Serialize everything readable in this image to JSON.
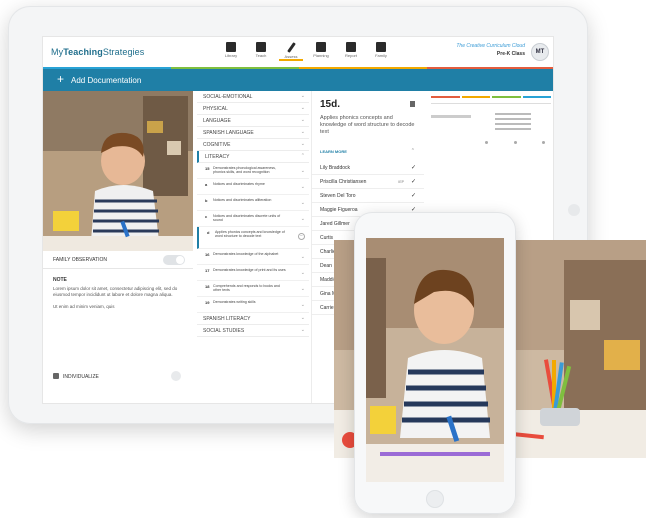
{
  "app": {
    "logo_prefix": "My",
    "logo_bold": "Teaching",
    "logo_suffix": "Strategies",
    "curriculum": "The Creative Curriculum Cloud",
    "class_name": "Pre-K Class",
    "avatar_initials": "MT"
  },
  "nav": [
    {
      "label": "Library",
      "icon": "library-icon"
    },
    {
      "label": "Teach",
      "icon": "teach-icon"
    },
    {
      "label": "Assess",
      "icon": "assess-pen-icon"
    },
    {
      "label": "Planning",
      "icon": "planning-icon"
    },
    {
      "label": "Report",
      "icon": "report-icon"
    },
    {
      "label": "Family",
      "icon": "family-icon"
    }
  ],
  "colors": {
    "brand": "#1f7fa6",
    "accent": "#f2a900"
  },
  "docbar": {
    "label": "Add Documentation"
  },
  "left": {
    "family_label": "FAMILY OBSERVATION",
    "note_heading": "NOTE",
    "note_body_1": "Lorem ipsum dolor sit amet, consectetur adipiscing elit, sed do eiusmod tempor incididunt ut labore et dolore magna aliqua.",
    "note_body_2": "Ut enim ad minim veniam, quis",
    "individualize": "INDIVIDUALIZE"
  },
  "domains_top": [
    "SOCIAL-EMOTIONAL",
    "PHYSICAL",
    "LANGUAGE",
    "SPANISH LANGUAGE",
    "COGNITIVE",
    "LITERACY"
  ],
  "objectives": [
    {
      "num": "15",
      "text": "Demonstrates phonological awareness, phonics skills, and word recognition"
    },
    {
      "num": "a",
      "text": "Notices and discriminates rhyme"
    },
    {
      "num": "b",
      "text": "Notices and discriminates alliteration"
    },
    {
      "num": "c",
      "text": "Notices and discriminates discrete units of sound"
    },
    {
      "num": "d",
      "text": "Applies phonics concepts and knowledge of word structure to decode text"
    },
    {
      "num": "16",
      "text": "Demonstrates knowledge of the alphabet"
    },
    {
      "num": "17",
      "text": "Demonstrates knowledge of print and its uses"
    },
    {
      "num": "18",
      "text": "Comprehends and responds to books and other texts"
    },
    {
      "num": "19",
      "text": "Demonstrates writing skills"
    }
  ],
  "domains_bottom": [
    "SPANISH LITERACY",
    "SOCIAL STUDIES"
  ],
  "detail": {
    "code": "15d.",
    "description": "Applies phonics concepts and knowledge of word structure to decode text",
    "learn_more": "LEARN MORE",
    "children": [
      {
        "name": "Lily Braddock",
        "tag": ""
      },
      {
        "name": "Priscilla Christiansen",
        "tag": "IEP"
      },
      {
        "name": "Steven Del Toro",
        "tag": ""
      },
      {
        "name": "Maggie Figueroa",
        "tag": ""
      },
      {
        "name": "Jared Gillmer",
        "tag": ""
      },
      {
        "name": "Curtis",
        "tag": ""
      },
      {
        "name": "Charlie",
        "tag": ""
      },
      {
        "name": "Dean",
        "tag": ""
      },
      {
        "name": "Maddie",
        "tag": ""
      },
      {
        "name": "Gina M",
        "tag": ""
      },
      {
        "name": "Carrie N",
        "tag": ""
      }
    ]
  }
}
